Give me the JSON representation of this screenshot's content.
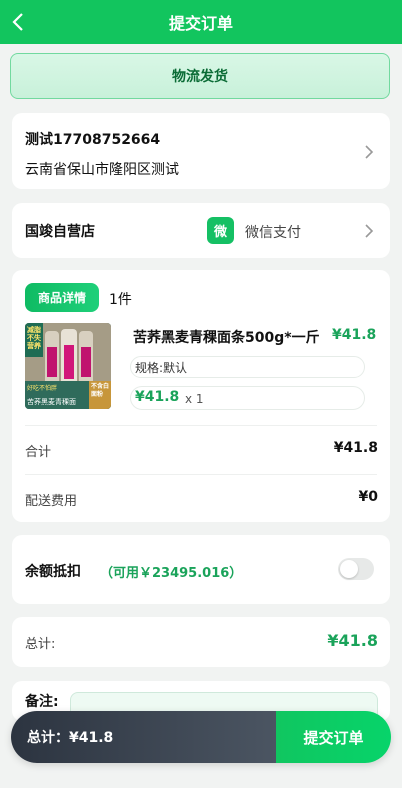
{
  "header": {
    "title": "提交订单",
    "back_icon": "chevron-left-icon"
  },
  "shipping": {
    "label": "物流发货"
  },
  "address": {
    "name_phone": "测试17708752664",
    "location": "云南省保山市隆阳区测试"
  },
  "shop": {
    "name": "国竣自营店",
    "pay_badge": "微",
    "pay_method": "微信支付"
  },
  "goods": {
    "tag": "商品详情",
    "count": "1件",
    "product": {
      "name": "苦荞黑麦青稞面条500g*一斤",
      "price": "¥41.8",
      "spec": "规格:默认",
      "unit_price": "¥41.8",
      "quantity": "x 1",
      "image_texts": {
        "top": "减脂不失营养",
        "left_bottom": "好吃不怕胖",
        "right_bottom": "不含白面粉",
        "caption": "苦荞黑麦青稞面"
      }
    },
    "subtotal": {
      "label": "合计",
      "value": "¥41.8"
    },
    "delivery": {
      "label": "配送费用",
      "value": "¥0"
    }
  },
  "balance": {
    "label": "余额抵扣",
    "available": "（可用￥23495.016）",
    "enabled": false
  },
  "total": {
    "label": "总计:",
    "value": "¥41.8"
  },
  "remark": {
    "label": "备注:"
  },
  "footer": {
    "sum": "总计：¥41.8",
    "submit": "提交订单"
  },
  "colors": {
    "brand": "#12c55e",
    "price": "#1aa35a",
    "footer_dark": "#2c3440"
  }
}
